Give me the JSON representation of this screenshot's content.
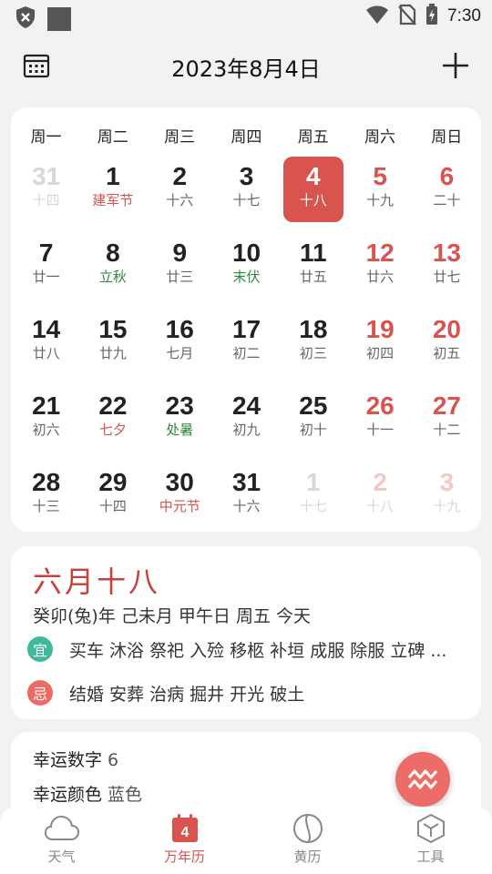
{
  "status_bar": {
    "time": "7:30"
  },
  "header": {
    "title": "2023年8月4日"
  },
  "calendar": {
    "weekdays": [
      "周一",
      "周二",
      "周三",
      "周四",
      "周五",
      "周六",
      "周日"
    ],
    "weeks": [
      [
        {
          "num": "31",
          "sub": "十四",
          "other": true
        },
        {
          "num": "1",
          "sub": "建军节",
          "sub_color": "red"
        },
        {
          "num": "2",
          "sub": "十六"
        },
        {
          "num": "3",
          "sub": "十七"
        },
        {
          "num": "4",
          "sub": "十八",
          "today": true
        },
        {
          "num": "5",
          "sub": "十九",
          "weekend": true
        },
        {
          "num": "6",
          "sub": "二十",
          "weekend": true
        }
      ],
      [
        {
          "num": "7",
          "sub": "廿一"
        },
        {
          "num": "8",
          "sub": "立秋",
          "sub_color": "green"
        },
        {
          "num": "9",
          "sub": "廿三"
        },
        {
          "num": "10",
          "sub": "末伏",
          "sub_color": "green"
        },
        {
          "num": "11",
          "sub": "廿五"
        },
        {
          "num": "12",
          "sub": "廿六",
          "weekend": true
        },
        {
          "num": "13",
          "sub": "廿七",
          "weekend": true
        }
      ],
      [
        {
          "num": "14",
          "sub": "廿八"
        },
        {
          "num": "15",
          "sub": "廿九"
        },
        {
          "num": "16",
          "sub": "七月"
        },
        {
          "num": "17",
          "sub": "初二"
        },
        {
          "num": "18",
          "sub": "初三"
        },
        {
          "num": "19",
          "sub": "初四",
          "weekend": true
        },
        {
          "num": "20",
          "sub": "初五",
          "weekend": true
        }
      ],
      [
        {
          "num": "21",
          "sub": "初六"
        },
        {
          "num": "22",
          "sub": "七夕",
          "sub_color": "red"
        },
        {
          "num": "23",
          "sub": "处暑",
          "sub_color": "green"
        },
        {
          "num": "24",
          "sub": "初九"
        },
        {
          "num": "25",
          "sub": "初十"
        },
        {
          "num": "26",
          "sub": "十一",
          "weekend": true
        },
        {
          "num": "27",
          "sub": "十二",
          "weekend": true
        }
      ],
      [
        {
          "num": "28",
          "sub": "十三"
        },
        {
          "num": "29",
          "sub": "十四"
        },
        {
          "num": "30",
          "sub": "中元节",
          "sub_color": "red"
        },
        {
          "num": "31",
          "sub": "十六"
        },
        {
          "num": "1",
          "sub": "十七",
          "other": true
        },
        {
          "num": "2",
          "sub": "十八",
          "other": true,
          "weekend": true
        },
        {
          "num": "3",
          "sub": "十九",
          "other": true,
          "weekend": true
        }
      ]
    ]
  },
  "day_info": {
    "lunar_date": "六月十八",
    "ganzhi": "癸卯(兔)年 己未月 甲午日 周五 今天",
    "yi_badge": "宜",
    "yi_text": "买车 沐浴 祭祀 入殓 移柩 补垣 成服 除服 立碑 ...",
    "ji_badge": "忌",
    "ji_text": "结婚 安葬 治病 掘井 开光 破土"
  },
  "lucky": {
    "number_label": "幸运数字",
    "number_value": "6",
    "color_label": "幸运颜色",
    "color_value": "蓝色"
  },
  "bottom_nav": [
    {
      "label": "天气",
      "icon": "cloud-icon"
    },
    {
      "label": "万年历",
      "icon": "calendar-icon",
      "active": true,
      "badge": "4"
    },
    {
      "label": "黄历",
      "icon": "yinyang-icon"
    },
    {
      "label": "工具",
      "icon": "cube-icon"
    }
  ],
  "colors": {
    "accent": "#d9534f",
    "yi": "#3fb99a",
    "ji": "#ee6b63",
    "festival_green": "#2e8b3a"
  }
}
